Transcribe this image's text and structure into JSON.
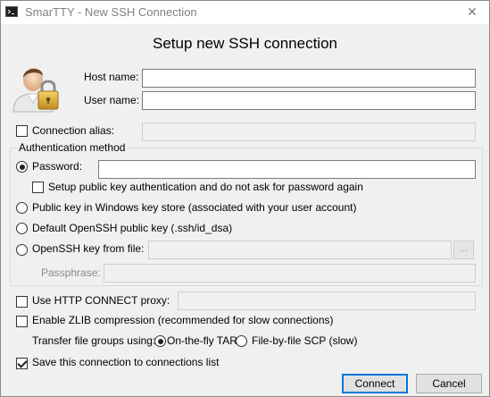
{
  "window": {
    "title": "SmarTTY - New SSH Connection",
    "close_glyph": "✕",
    "app_icon": "terminal-icon"
  },
  "heading": "Setup new SSH connection",
  "avatar_icon": "user-lock-icon",
  "host": {
    "label": "Host name:",
    "value": ""
  },
  "user": {
    "label": "User name:",
    "value": ""
  },
  "alias": {
    "label": "Connection alias:",
    "checked": false,
    "value": ""
  },
  "auth": {
    "group_label": "Authentication method",
    "password": {
      "label": "Password:",
      "selected": true,
      "value": ""
    },
    "setup_pubkey": {
      "label": "Setup public key authentication and do not ask for password again",
      "checked": false
    },
    "windows_key_store": {
      "label": "Public key in Windows key store (associated with your user account)",
      "selected": false
    },
    "default_openssh": {
      "label": "Default OpenSSH public key (.ssh/id_dsa)",
      "selected": false
    },
    "openssh_file": {
      "label": "OpenSSH key from file:",
      "selected": false,
      "value": "",
      "browse_label": "..."
    },
    "passphrase": {
      "label": "Passphrase:",
      "value": ""
    }
  },
  "http_proxy": {
    "label": "Use HTTP CONNECT proxy:",
    "checked": false,
    "value": ""
  },
  "zlib": {
    "label": "Enable ZLIB compression (recommended for slow connections)",
    "checked": false
  },
  "transfer": {
    "label": "Transfer file groups using:",
    "option_tar": {
      "label": "On-the-fly TAR",
      "selected": true
    },
    "option_scp": {
      "label": "File-by-file SCP (slow)",
      "selected": false
    }
  },
  "save_connection": {
    "label": "Save this connection to connections list",
    "checked": true
  },
  "buttons": {
    "connect": "Connect",
    "cancel": "Cancel"
  },
  "colors": {
    "default_button_border": "#0078d7",
    "background": "#f0f0f0"
  }
}
